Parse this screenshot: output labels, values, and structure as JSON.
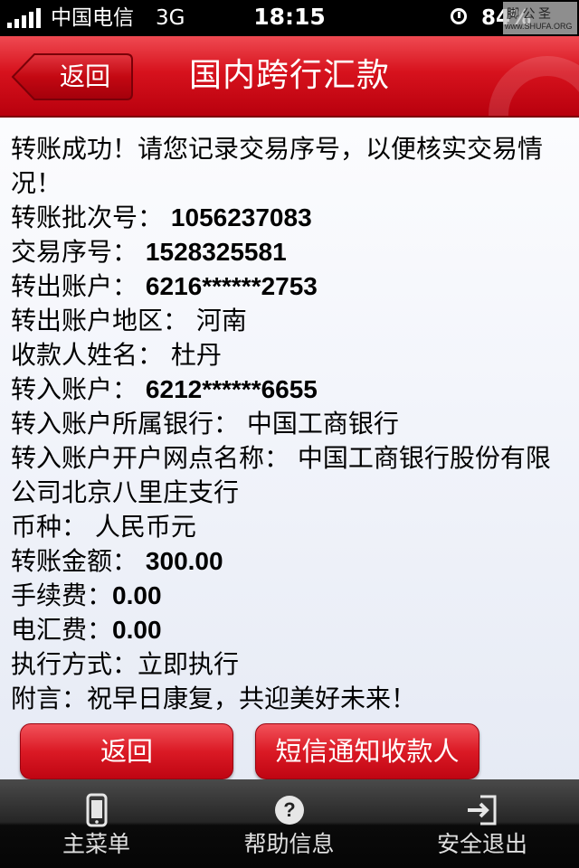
{
  "status_bar": {
    "carrier": "中国电信",
    "network": "3G",
    "time": "18:15",
    "battery": "84%",
    "watermark_text": "脚 公 圣",
    "watermark_url": "www.SHUFA.ORG"
  },
  "nav": {
    "back_label": "返回",
    "title": "国内跨行汇款"
  },
  "details": {
    "message": "转账成功！请您记录交易序号，以便核实交易情况！",
    "rows": [
      {
        "label": "转账批次号：",
        "value": "1056237083"
      },
      {
        "label": "交易序号：",
        "value": "1528325581"
      },
      {
        "label": "转出账户：",
        "value": "6216******2753"
      },
      {
        "label": "转出账户地区：",
        "value": "河南"
      },
      {
        "label": "收款人姓名：",
        "value": "杜丹"
      },
      {
        "label": "转入账户：",
        "value": "6212******6655"
      },
      {
        "label": "转入账户所属银行：",
        "value": "中国工商银行"
      },
      {
        "label": "转入账户开户网点名称：",
        "value": "中国工商银行股份有限公司北京八里庄支行"
      },
      {
        "label": "币种：",
        "value": "人民币元"
      },
      {
        "label": "转账金额：",
        "value": "300.00"
      },
      {
        "label": "手续费：",
        "value": "0.00"
      },
      {
        "label": "电汇费：",
        "value": "0.00"
      },
      {
        "label": "执行方式：",
        "value": "立即执行"
      },
      {
        "label": "附言：",
        "value": "祝早日康复，共迎美好未来！"
      }
    ]
  },
  "actions": {
    "back_label": "返回",
    "sms_label": "短信通知收款人"
  },
  "tabbar": {
    "items": [
      {
        "label": "主菜单",
        "icon": "phone-icon"
      },
      {
        "label": "帮助信息",
        "icon": "help-icon"
      },
      {
        "label": "安全退出",
        "icon": "logout-icon"
      }
    ]
  },
  "colors": {
    "brand_red": "#d7121d",
    "tabbar_dark": "#1a1a1a"
  }
}
